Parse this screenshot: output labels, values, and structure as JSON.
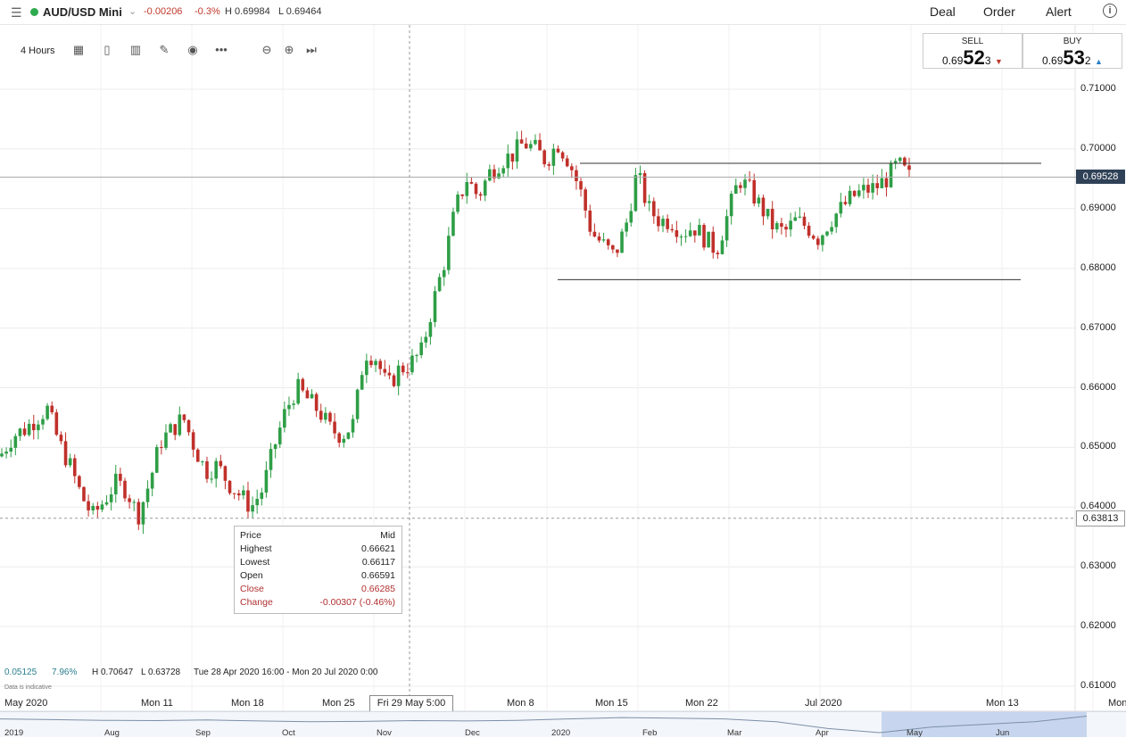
{
  "topbar": {
    "menu_icon": "hamburger-icon",
    "symbol": "AUD/USD Mini",
    "status_color": "#2eaa4f",
    "change": "-0.00206",
    "change_pct": "-0.3%",
    "high": "H 0.69984",
    "low": "L 0.69464",
    "nav": [
      "Deal",
      "Order",
      "Alert"
    ],
    "info_icon": "info-icon"
  },
  "toolbar": {
    "timeframe": "4 Hours",
    "icons": [
      "calculator-icon",
      "tablet-icon",
      "bar-chart-icon",
      "pencil-icon",
      "eye-icon",
      "more-icon",
      "zoom-out-icon",
      "zoom-in-icon",
      "skip-end-icon"
    ]
  },
  "sell": {
    "label": "SELL",
    "prefix": "0.69",
    "big": "52",
    "sub": "3",
    "arrow": "▼",
    "color": "#c0392b"
  },
  "buy": {
    "label": "BUY",
    "prefix": "0.69",
    "big": "53",
    "sub": "2",
    "arrow": "▲",
    "color": "#2a7fc4"
  },
  "tooltip": {
    "rows": [
      {
        "k": "Price",
        "v": "Mid",
        "red": false
      },
      {
        "k": "Highest",
        "v": "0.66621",
        "red": false
      },
      {
        "k": "Lowest",
        "v": "0.66117",
        "red": false
      },
      {
        "k": "Open",
        "v": "0.66591",
        "red": false
      },
      {
        "k": "Close",
        "v": "0.66285",
        "red": true
      },
      {
        "k": "Change",
        "v": "-0.00307 (-0.46%)",
        "red": true
      }
    ]
  },
  "stats": {
    "a": "0.05125",
    "b": "7.96%",
    "h": "H 0.70647",
    "l": "L 0.63728",
    "range": "Tue 28 Apr 2020 16:00 - Mon 20 Jul 2020 0:00"
  },
  "disclaimer": "Data is indicative",
  "current_price": "0.69528",
  "cursor_price": "0.63813",
  "cursor_time": "Fri 29 May 5:00",
  "nav_labels": [
    "2019",
    "Aug",
    "Sep",
    "Oct",
    "Nov",
    "Dec",
    "2020",
    "Feb",
    "Mar",
    "Apr",
    "May",
    "Jun"
  ],
  "chart_data": {
    "type": "candlestick",
    "title": "AUD/USD Mini",
    "timeframe": "4 Hours",
    "y_axis_ticks": [
      "0.71000",
      "0.70000",
      "0.69000",
      "0.68000",
      "0.67000",
      "0.66000",
      "0.65000",
      "0.64000",
      "0.63000",
      "0.62000",
      "0.61000"
    ],
    "ylim": [
      0.6075,
      0.7142
    ],
    "x_axis_labels": [
      "May 2020",
      "Mon 11",
      "Mon 18",
      "Mon 25",
      "Mon 8",
      "Mon 15",
      "Mon 22",
      "Jul 2020",
      "Mon 13",
      "Mon"
    ],
    "close_path": [
      0.649,
      0.652,
      0.653,
      0.6548,
      0.6565,
      0.651,
      0.647,
      0.642,
      0.6385,
      0.641,
      0.644,
      0.643,
      0.6385,
      0.644,
      0.651,
      0.653,
      0.655,
      0.65,
      0.646,
      0.647,
      0.644,
      0.642,
      0.64,
      0.643,
      0.65,
      0.656,
      0.66,
      0.658,
      0.656,
      0.653,
      0.652,
      0.654,
      0.666,
      0.665,
      0.66,
      0.663,
      0.664,
      0.666,
      0.674,
      0.681,
      0.69,
      0.695,
      0.692,
      0.696,
      0.698,
      0.699,
      0.701,
      0.7,
      0.698,
      0.701,
      0.698,
      0.693,
      0.686,
      0.684,
      0.682,
      0.687,
      0.696,
      0.69,
      0.688,
      0.688,
      0.686,
      0.687,
      0.685,
      0.683,
      0.689,
      0.695,
      0.693,
      0.69,
      0.687,
      0.686,
      0.688,
      0.687,
      0.685,
      0.688,
      0.69,
      0.692,
      0.693,
      0.6935,
      0.695,
      0.6975,
      0.6953
    ],
    "horizontal_lines": [
      {
        "label": "resistance",
        "y": 0.6976
      },
      {
        "label": "support",
        "y": 0.6781
      },
      {
        "label": "current price",
        "y": 0.69528
      },
      {
        "label": "cursor price",
        "y": 0.63813
      }
    ],
    "stats": {
      "change": "0.05125",
      "change_pct": "7.96%",
      "high": 0.70647,
      "low": 0.63728
    },
    "up_color": "#2e9e46",
    "down_color": "#c0302a",
    "grid": true
  }
}
